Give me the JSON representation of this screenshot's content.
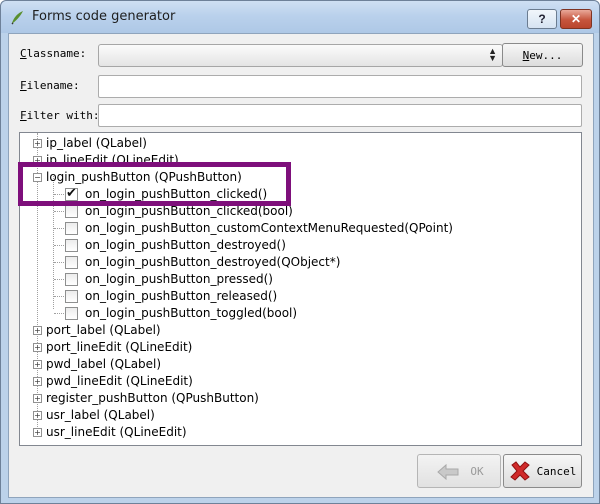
{
  "window": {
    "title": "Forms code generator",
    "help_label": "?",
    "close_label": "✕"
  },
  "form": {
    "classname_label_u": "C",
    "classname_label_rest": "lassname:",
    "filename_label_u": "F",
    "filename_label_rest": "ilename:",
    "filter_label_u": "F",
    "filter_label_rest": "ilter with:",
    "classname_value": "",
    "filename_value": "",
    "filter_value": "",
    "new_button_u": "N",
    "new_button_rest": "ew..."
  },
  "tree": {
    "items": [
      {
        "label": "ip_label (QLabel)"
      },
      {
        "label": "ip_lineEdit (QLineEdit)"
      },
      {
        "label": "login_pushButton (QPushButton)",
        "children": [
          {
            "label": "on_login_pushButton_clicked()",
            "checked": true
          },
          {
            "label": "on_login_pushButton_clicked(bool)",
            "checked": false
          },
          {
            "label": "on_login_pushButton_customContextMenuRequested(QPoint)",
            "checked": false
          },
          {
            "label": "on_login_pushButton_destroyed()",
            "checked": false
          },
          {
            "label": "on_login_pushButton_destroyed(QObject*)",
            "checked": false
          },
          {
            "label": "on_login_pushButton_pressed()",
            "checked": false
          },
          {
            "label": "on_login_pushButton_released()",
            "checked": false
          },
          {
            "label": "on_login_pushButton_toggled(bool)",
            "checked": false
          }
        ]
      },
      {
        "label": "port_label (QLabel)"
      },
      {
        "label": "port_lineEdit (QLineEdit)"
      },
      {
        "label": "pwd_label (QLabel)"
      },
      {
        "label": "pwd_lineEdit (QLineEdit)"
      },
      {
        "label": "register_pushButton (QPushButton)"
      },
      {
        "label": "usr_label (QLabel)"
      },
      {
        "label": "usr_lineEdit (QLineEdit)"
      }
    ]
  },
  "buttons": {
    "ok_label": "OK",
    "cancel_label": "Cancel"
  },
  "colors": {
    "highlight_box": "#7e0f7b"
  }
}
